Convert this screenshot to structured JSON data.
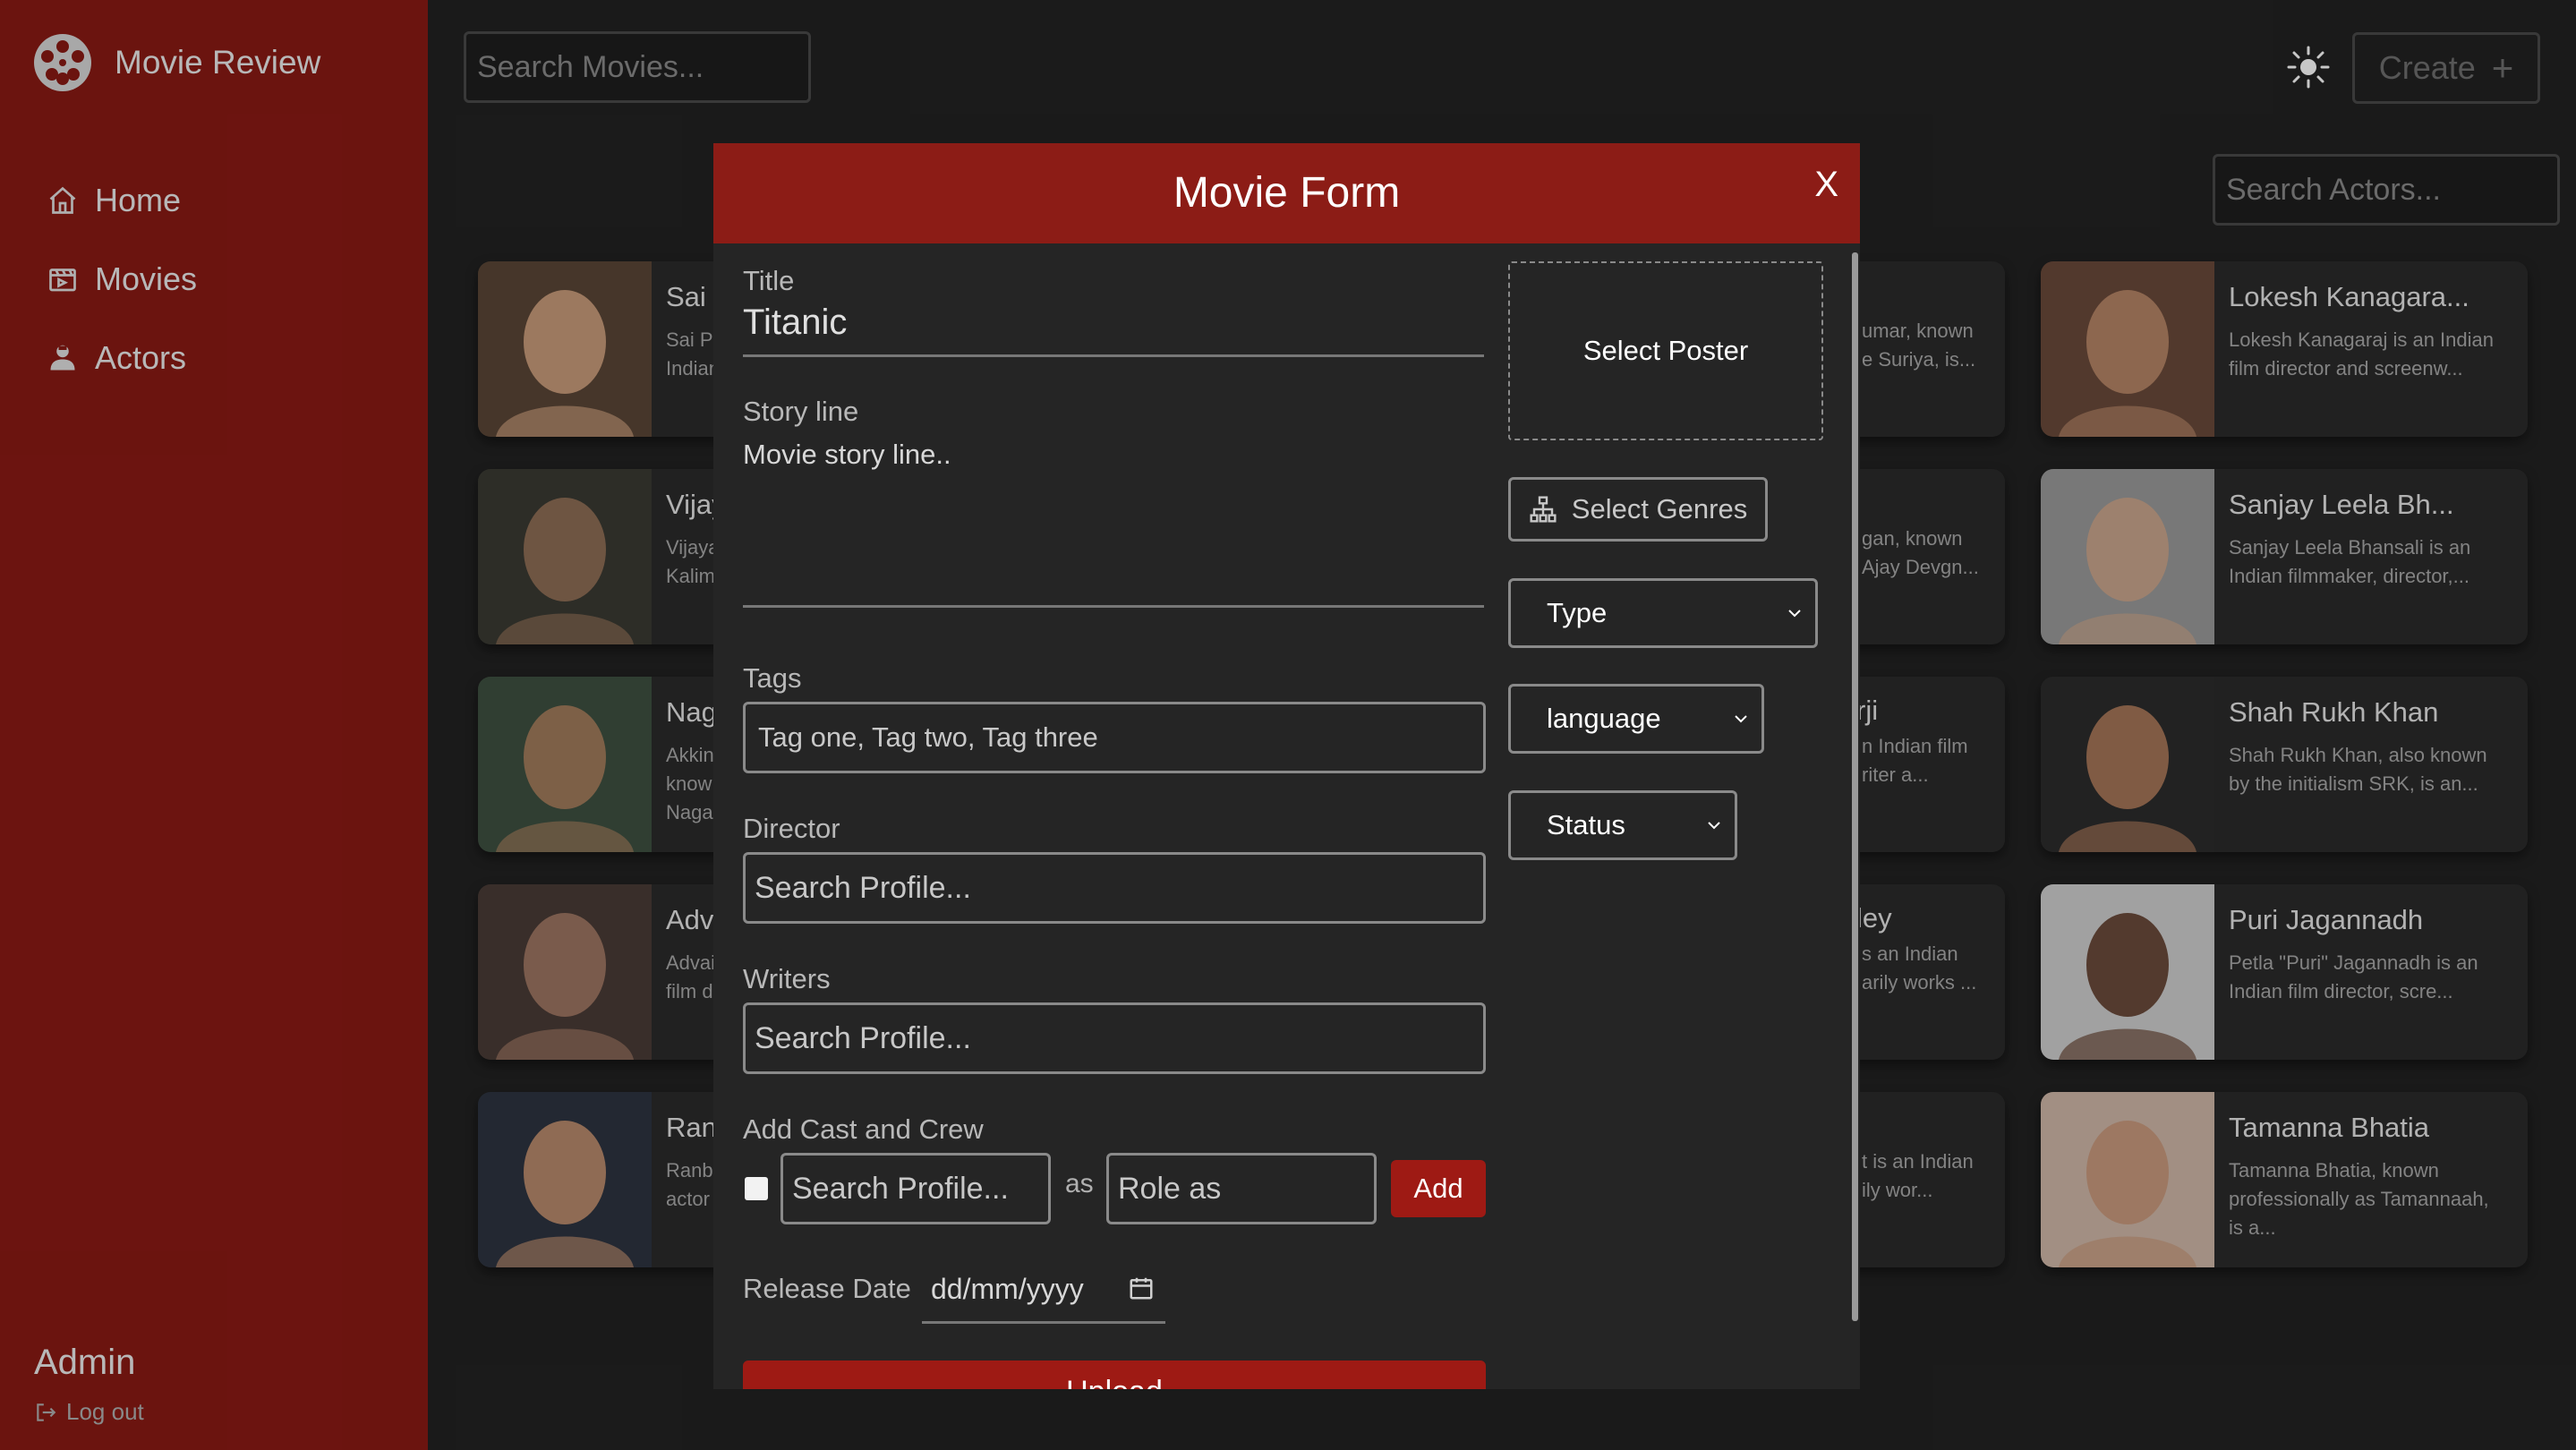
{
  "app": {
    "name": "Movie Review",
    "user": "Admin",
    "logout": "Log out"
  },
  "nav": [
    {
      "label": "Home",
      "icon": "home-icon"
    },
    {
      "label": "Movies",
      "icon": "film-icon"
    },
    {
      "label": "Actors",
      "icon": "user-icon"
    }
  ],
  "header": {
    "search_movies_placeholder": "Search Movies...",
    "create_label": "Create",
    "create_icon": "+",
    "search_actors_placeholder": "Search Actors..."
  },
  "actors_left": [
    {
      "name": "Sai P",
      "desc": [
        "Sai Pa",
        "Indian"
      ]
    },
    {
      "name": "Vijay",
      "desc": [
        "Vijaya",
        "Kalim"
      ]
    },
    {
      "name": "Nag",
      "desc": [
        "Akkin",
        "know",
        "Nagar"
      ]
    },
    {
      "name": "Adv",
      "desc": [
        "Advai",
        "film d"
      ]
    },
    {
      "name": "Ranl",
      "desc": [
        "Ranbi",
        "actor"
      ]
    }
  ],
  "actors_middle_fragments": [
    {
      "title": "",
      "desc": [
        "umar, known",
        "e Suriya, is..."
      ]
    },
    {
      "title": "",
      "desc": [
        "gan, known",
        "Ajay Devgn..."
      ]
    },
    {
      "title": "rji",
      "desc": [
        "n Indian film",
        "riter a..."
      ]
    },
    {
      "title": "ley",
      "desc": [
        "s an Indian",
        "arily works ..."
      ]
    },
    {
      "title": "",
      "desc": [
        "t is an Indian",
        "ily wor..."
      ]
    }
  ],
  "actors_right": [
    {
      "name": "Lokesh Kanagara...",
      "desc": "Lokesh Kanagaraj is an Indian film director and screenw..."
    },
    {
      "name": "Sanjay Leela Bh...",
      "desc": "Sanjay Leela Bhansali is an Indian filmmaker, director,..."
    },
    {
      "name": "Shah Rukh Khan",
      "desc": "Shah Rukh Khan, also known by the initialism SRK, is an..."
    },
    {
      "name": "Puri Jagannadh",
      "desc": "Petla \"Puri\" Jagannadh is an Indian film director, scre..."
    },
    {
      "name": "Tamanna Bhatia",
      "desc": "Tamanna Bhatia, known professionally as Tamannaah, is a..."
    }
  ],
  "modal": {
    "title": "Movie Form",
    "close": "X",
    "title_label": "Title",
    "title_value": "Titanic",
    "storyline_label": "Story line",
    "storyline_placeholder": "Movie story line..",
    "tags_label": "Tags",
    "tags_placeholder": "Tag one, Tag two, Tag three",
    "director_label": "Director",
    "director_placeholder": "Search Profile...",
    "writers_label": "Writers",
    "writers_placeholder": "Search Profile...",
    "cast_label": "Add Cast and Crew",
    "cast_profile_placeholder": "Search Profile...",
    "cast_as": "as",
    "cast_role_placeholder": "Role as",
    "add_label": "Add",
    "release_label": "Release Date",
    "release_placeholder": "dd/mm/yyyy",
    "upload_label": "Upload",
    "poster_label": "Select Poster",
    "genres_label": "Select Genres",
    "type_label": "Type",
    "language_label": "language",
    "status_label": "Status"
  },
  "colors": {
    "sidebar": "#8a1a14",
    "accent": "#9e1a14",
    "background": "#222222"
  }
}
